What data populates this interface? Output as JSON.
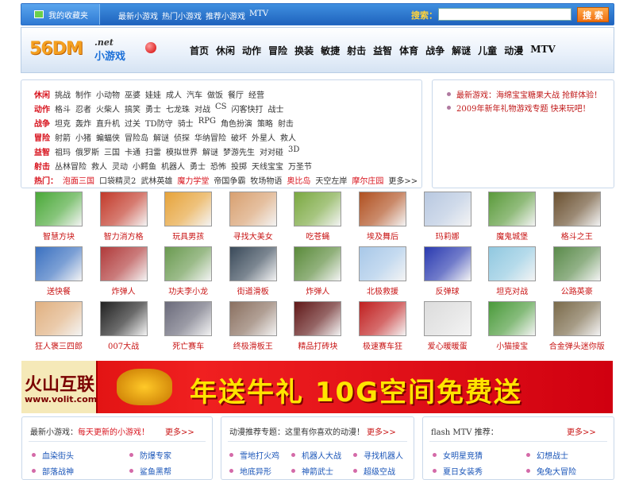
{
  "topbar": {
    "favorite": "我的收藏夹",
    "links": [
      "最新小游戏",
      "热门小游戏",
      "推荐小游戏",
      "MTV"
    ],
    "search_label": "搜索：",
    "search_button": "搜 索"
  },
  "logo": {
    "text": "56DM",
    "net": ".net",
    "cn": "小游戏"
  },
  "nav": [
    "首页",
    "休闲",
    "动作",
    "冒险",
    "换装",
    "敏捷",
    "射击",
    "益智",
    "体育",
    "战争",
    "解谜",
    "儿童",
    "动漫",
    "MTV"
  ],
  "categories": [
    {
      "head": "休闲",
      "items": [
        "挑战",
        "制作",
        "小动物",
        "巫婆",
        "娃娃",
        "成人",
        "汽车",
        "做饭",
        "餐厅",
        "经营"
      ]
    },
    {
      "head": "动作",
      "items": [
        "格斗",
        "忍者",
        "火柴人",
        "搞笑",
        "勇士",
        "七龙珠",
        "对战",
        "CS",
        "闪客快打",
        "战士"
      ]
    },
    {
      "head": "战争",
      "items": [
        "坦克",
        "轰炸",
        "直升机",
        "过关",
        "TD防守",
        "骑士",
        "RPG",
        "角色扮演",
        "策略",
        "射击"
      ]
    },
    {
      "head": "冒险",
      "items": [
        "射箭",
        "小猪",
        "蝙蝠侠",
        "冒险岛",
        "解谜",
        "侦探",
        "华纳冒险",
        "破坏",
        "外星人",
        "救人"
      ]
    },
    {
      "head": "益智",
      "items": [
        "祖玛",
        "俄罗斯",
        "三国",
        "卡通",
        "扫雷",
        "模拟世界",
        "解谜",
        "梦游先生",
        "对对碰",
        "3D"
      ]
    },
    {
      "head": "射击",
      "items": [
        "丛林冒险",
        "救人",
        "灵动",
        "小鳄鱼",
        "机器人",
        "勇士",
        "恐怖",
        "投掷",
        "天线宝宝",
        "万圣节"
      ]
    }
  ],
  "hot": {
    "head": "热门：",
    "items": [
      "泡面三国",
      "口袋精灵2",
      "武林英雄",
      "魔力学堂",
      "帝国争霸",
      "牧场物语",
      "奥比岛",
      "天空左岸",
      "摩尔庄园",
      "更多>>"
    ],
    "red": [
      1,
      0,
      0,
      1,
      0,
      0,
      1,
      0,
      1,
      0
    ]
  },
  "news": [
    "最新游戏：海绵宝宝糖果大战 抢鲜体验！",
    "2009年新年礼物游戏专题 快来玩吧！"
  ],
  "games": [
    {
      "name": "智慧方块",
      "c": "#4aa838"
    },
    {
      "name": "智力消方格",
      "c": "#c23a2a"
    },
    {
      "name": "玩具男孩",
      "c": "#e6a33a"
    },
    {
      "name": "寻找大美女",
      "c": "#d8a070"
    },
    {
      "name": "吃苍蝇",
      "c": "#7aa840"
    },
    {
      "name": "埃及舞后",
      "c": "#b05020"
    },
    {
      "name": "玛莉娜",
      "c": "#b8c8e0"
    },
    {
      "name": "魔鬼城堡",
      "c": "#5a9a3a"
    },
    {
      "name": "格斗之王",
      "c": "#6a5030"
    },
    {
      "name": "送快餐",
      "c": "#3a70c0"
    },
    {
      "name": "炸弹人",
      "c": "#b03a3a"
    },
    {
      "name": "功夫李小龙",
      "c": "#6a9a50"
    },
    {
      "name": "街道滑板",
      "c": "#3a4a5a"
    },
    {
      "name": "炸弹人",
      "c": "#5a8a3a"
    },
    {
      "name": "北极救援",
      "c": "#a8c8e8"
    },
    {
      "name": "反弹球",
      "c": "#2a3ab0"
    },
    {
      "name": "坦克对战",
      "c": "#90c8e0"
    },
    {
      "name": "公路英豪",
      "c": "#5a8a4a"
    },
    {
      "name": "狂人褒三四郎",
      "c": "#e0b080"
    },
    {
      "name": "007大战",
      "c": "#222222"
    },
    {
      "name": "死亡赛车",
      "c": "#6a6a7a"
    },
    {
      "name": "终极滑板王",
      "c": "#8a7060"
    },
    {
      "name": "精品打砖块",
      "c": "#601818"
    },
    {
      "name": "极速赛车狂",
      "c": "#c02020"
    },
    {
      "name": "爱心暖暖蛋",
      "c": "#dcdcdc"
    },
    {
      "name": "小猫接宝",
      "c": "#4a9a3a"
    },
    {
      "name": "合金弹头迷你版",
      "c": "#7a6a4a"
    }
  ],
  "banner": {
    "brand": "火山互联",
    "url": "www.volit.com",
    "slogan": "年送牛礼 10G空间免费送"
  },
  "panels": [
    {
      "title": "最新小游戏：",
      "title_red": "每天更新的小游戏！",
      "more": "更多>>",
      "items": [
        "血染街头",
        "防爆专家",
        "部落战神",
        "鲨鱼黑帮"
      ]
    },
    {
      "title": "动漫推荐专题：这里有你喜欢的动漫！",
      "more": "更多>>",
      "items": [
        "雪地打火鸡",
        "机器人大战",
        "寻找机器人",
        "地底异形",
        "神箭武士",
        "超级空战"
      ]
    },
    {
      "title": "flash MTV 推荐：",
      "more": "更多>>",
      "items": [
        "女明星竞猜",
        "幻想战士",
        "夏日女装秀",
        "兔兔大冒险"
      ]
    }
  ]
}
